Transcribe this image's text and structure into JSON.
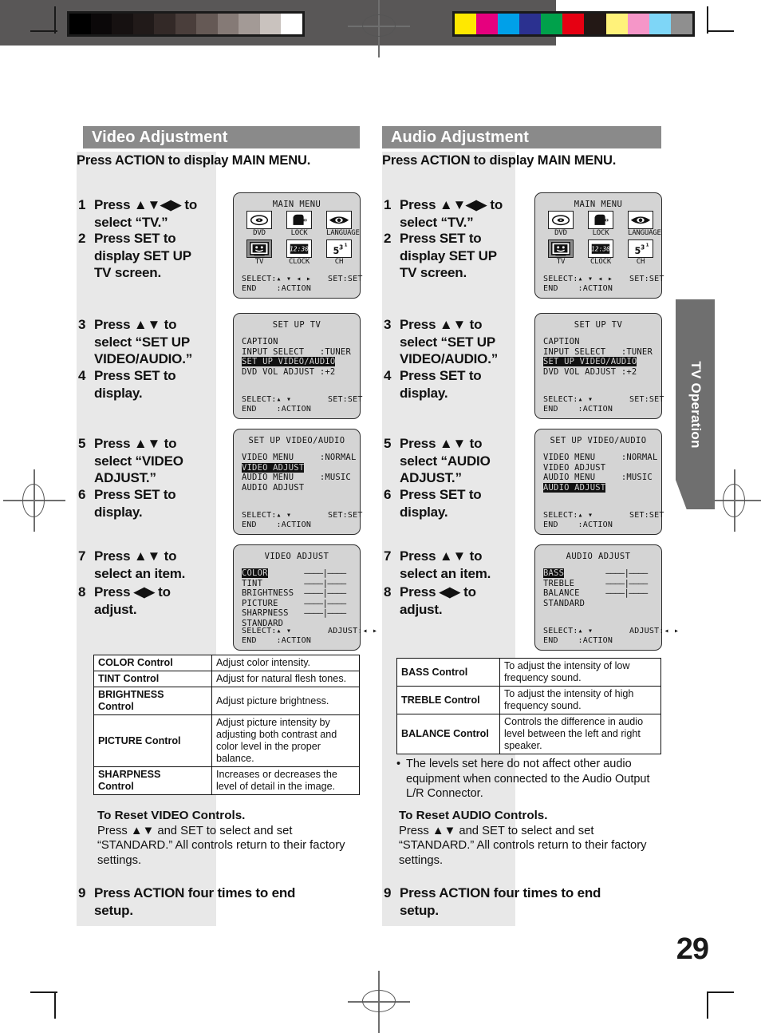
{
  "page": {
    "number": "29",
    "side_tab": "TV Operation"
  },
  "calibration": {
    "gray_steps": [
      "#000000",
      "#0b0809",
      "#161111",
      "#211a19",
      "#332927",
      "#4a3e3b",
      "#655955",
      "#857a76",
      "#a39a96",
      "#c9c2be",
      "#ffffff"
    ],
    "color_steps": [
      "#ffe800",
      "#e6007e",
      "#00a0e9",
      "#2b3190",
      "#00a14b",
      "#e60012",
      "#231815",
      "#fff27a",
      "#f596c8",
      "#7ed6f7",
      "#8f8f8f"
    ]
  },
  "left": {
    "title": "Video Adjustment",
    "lead": "Press ACTION to display MAIN MENU.",
    "steps": [
      {
        "num": "1",
        "text": "Press ▲▼◀▶ to\nselect “TV.”"
      },
      {
        "num": "2",
        "text": "Press SET to\ndisplay SET UP\nTV screen."
      },
      {
        "num": "3",
        "text": "Press ▲▼ to\nselect “SET UP\nVIDEO/AUDIO.”"
      },
      {
        "num": "4",
        "text": "Press SET to\ndisplay."
      },
      {
        "num": "5",
        "text": "Press ▲▼ to\nselect “VIDEO\nADJUST.”"
      },
      {
        "num": "6",
        "text": "Press SET to\ndisplay."
      },
      {
        "num": "7",
        "text": "Press ▲▼ to\nselect an item."
      },
      {
        "num": "8",
        "text": "Press ◀▶ to\nadjust."
      },
      {
        "num": "9",
        "text": "Press ACTION four times to end\nsetup."
      }
    ],
    "table": {
      "rows": [
        {
          "key": "COLOR Control",
          "desc": "Adjust color intensity."
        },
        {
          "key": "TINT Control",
          "desc": "Adjust for natural flesh tones."
        },
        {
          "key": "BRIGHTNESS\nControl",
          "desc": "Adjust picture brightness."
        },
        {
          "key": "PICTURE Control",
          "desc": "Adjust picture intensity by adjusting both contrast and color level in the proper balance."
        },
        {
          "key": "SHARPNESS\nControl",
          "desc": "Increases or decreases the level of detail in the image."
        }
      ]
    },
    "reset": {
      "heading": "To Reset VIDEO Controls.",
      "body": "Press ▲▼ and SET to select and set “STANDARD.” All controls return to their factory settings."
    }
  },
  "right": {
    "title": "Audio Adjustment",
    "lead": "Press ACTION to display MAIN MENU.",
    "steps": [
      {
        "num": "1",
        "text": "Press ▲▼◀▶ to\nselect “TV.”"
      },
      {
        "num": "2",
        "text": "Press SET to\ndisplay SET UP\nTV screen."
      },
      {
        "num": "3",
        "text": "Press ▲▼ to\nselect “SET UP\nVIDEO/AUDIO.”"
      },
      {
        "num": "4",
        "text": "Press SET to\ndisplay."
      },
      {
        "num": "5",
        "text": "Press ▲▼ to\nselect “AUDIO\nADJUST.”"
      },
      {
        "num": "6",
        "text": "Press SET to\ndisplay."
      },
      {
        "num": "7",
        "text": "Press ▲▼ to\nselect an item."
      },
      {
        "num": "8",
        "text": "Press ◀▶ to\nadjust."
      },
      {
        "num": "9",
        "text": "Press ACTION four times to end\nsetup."
      }
    ],
    "table": {
      "rows": [
        {
          "key": "BASS Control",
          "desc": "To adjust the intensity of low frequency sound."
        },
        {
          "key": "TREBLE Control",
          "desc": "To adjust the intensity of high frequency sound."
        },
        {
          "key": "BALANCE Control",
          "desc": "Controls the difference in audio level between the left and right speaker."
        }
      ]
    },
    "note": "The levels set here do not affect other audio equipment when connected to the Audio Output L/R Connector.",
    "reset": {
      "heading": "To Reset AUDIO Controls.",
      "body": "Press ▲▼ and SET to select and set “STANDARD.” All controls return to their factory settings."
    }
  },
  "osd": {
    "main_menu": {
      "title": "MAIN MENU",
      "items": [
        {
          "label": "DVD",
          "icon": "dvd-disc-icon",
          "selected": false
        },
        {
          "label": "LOCK",
          "icon": "lock-icon",
          "selected": false
        },
        {
          "label": "LANGUAGE",
          "icon": "language-icon",
          "selected": false
        },
        {
          "label": "TV",
          "icon": "tv-icon",
          "selected": true
        },
        {
          "label": "CLOCK",
          "icon": "clock-icon",
          "selected": false
        },
        {
          "label": "CH",
          "icon": "channel-icon",
          "selected": false
        }
      ],
      "footer_left": "SELECT:▴ ▾ ◂ ▸",
      "footer_right": "SET:SET",
      "footer_end": "END    :ACTION"
    },
    "set_up_tv": {
      "title": "SET UP TV",
      "rows": [
        {
          "label": "CAPTION",
          "value": "",
          "highlight": false
        },
        {
          "label": "INPUT SELECT",
          "value": ":TUNER",
          "highlight": false
        },
        {
          "label": "SET UP VIDEO/AUDIO",
          "value": "",
          "highlight": true
        },
        {
          "label": "DVD VOL ADJUST",
          "value": ":+2",
          "highlight": false
        }
      ],
      "footer_left": "SELECT:▴ ▾",
      "footer_right": "SET:SET",
      "footer_end": "END    :ACTION"
    },
    "set_up_av_video": {
      "title": "SET UP VIDEO/AUDIO",
      "rows": [
        {
          "label": "VIDEO MENU",
          "value": ":NORMAL",
          "highlight": false
        },
        {
          "label": "VIDEO ADJUST",
          "value": "",
          "highlight": true
        },
        {
          "label": "AUDIO MENU",
          "value": ":MUSIC",
          "highlight": false
        },
        {
          "label": "AUDIO ADJUST",
          "value": "",
          "highlight": false
        }
      ],
      "footer_left": "SELECT:▴ ▾",
      "footer_right": "SET:SET",
      "footer_end": "END    :ACTION"
    },
    "set_up_av_audio": {
      "title": "SET UP VIDEO/AUDIO",
      "rows": [
        {
          "label": "VIDEO MENU",
          "value": ":NORMAL",
          "highlight": false
        },
        {
          "label": "VIDEO ADJUST",
          "value": "",
          "highlight": false
        },
        {
          "label": "AUDIO MENU",
          "value": ":MUSIC",
          "highlight": false
        },
        {
          "label": "AUDIO ADJUST",
          "value": "",
          "highlight": true
        }
      ],
      "footer_left": "SELECT:▴ ▾",
      "footer_right": "SET:SET",
      "footer_end": "END    :ACTION"
    },
    "video_adjust": {
      "title": "VIDEO ADJUST",
      "bar": "————|————",
      "rows": [
        {
          "label": "COLOR",
          "bar": true,
          "highlight": true
        },
        {
          "label": "TINT",
          "bar": true,
          "highlight": false
        },
        {
          "label": "BRIGHTNESS",
          "bar": true,
          "highlight": false
        },
        {
          "label": "PICTURE",
          "bar": true,
          "highlight": false
        },
        {
          "label": "SHARPNESS",
          "bar": true,
          "highlight": false
        },
        {
          "label": "STANDARD",
          "bar": false,
          "highlight": false
        }
      ],
      "footer_left": "SELECT:▴ ▾",
      "footer_right": "ADJUST:◂ ▸",
      "footer_end": "END    :ACTION"
    },
    "audio_adjust": {
      "title": "AUDIO ADJUST",
      "bar": "————|————",
      "rows": [
        {
          "label": "BASS",
          "bar": true,
          "highlight": true
        },
        {
          "label": "TREBLE",
          "bar": true,
          "highlight": false
        },
        {
          "label": "BALANCE",
          "bar": true,
          "highlight": false
        },
        {
          "label": "STANDARD",
          "bar": false,
          "highlight": false
        }
      ],
      "footer_left": "SELECT:▴ ▾",
      "footer_right": "ADJUST:◂ ▸",
      "footer_end": "END    :ACTION"
    }
  }
}
